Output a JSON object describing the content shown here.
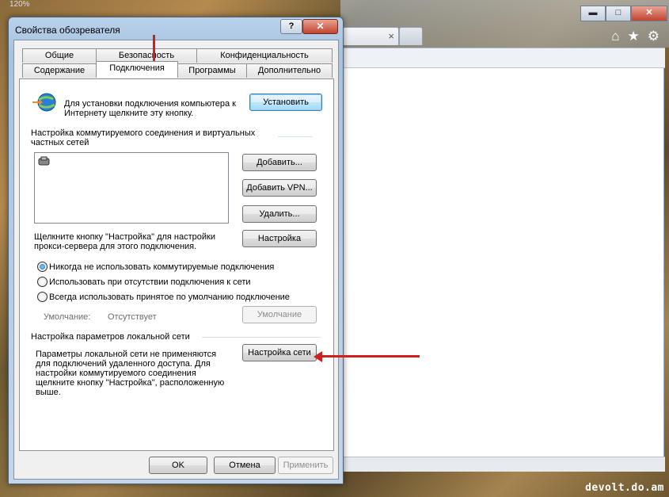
{
  "background": {
    "zoom": "120%",
    "watermark": "devolt.do.am",
    "window_controls": {
      "minimize": "▬",
      "maximize": "□",
      "close": "✕"
    },
    "tab_close": "×",
    "icons": [
      "home-icon",
      "star-icon",
      "gear-icon"
    ]
  },
  "dialog": {
    "title": "Свойства обозревателя",
    "help_label": "?",
    "close_label": "✕",
    "tabs_row1": [
      "Общие",
      "Безопасность",
      "Конфиденциальность"
    ],
    "tabs_row2": [
      "Содержание",
      "Подключения",
      "Программы",
      "Дополнительно"
    ],
    "active_tab": "Подключения",
    "setup": {
      "text": "Для установки подключения компьютера к Интернету щелкните эту кнопку.",
      "button": "Установить"
    },
    "dialup": {
      "header": "Настройка коммутируемого соединения и виртуальных частных сетей",
      "add": "Добавить...",
      "add_vpn": "Добавить VPN...",
      "remove": "Удалить...",
      "settings_text": "Щелкните кнопку \"Настройка\" для настройки прокси-сервера для этого подключения.",
      "settings_button": "Настройка"
    },
    "radios": [
      {
        "label": "Никогда не использовать коммутируемые подключения",
        "checked": true
      },
      {
        "label": "Использовать при отсутствии подключения к сети",
        "checked": false
      },
      {
        "label": "Всегда использовать принятое по умолчанию подключение",
        "checked": false
      }
    ],
    "default_row": {
      "label": "Умолчание:",
      "value": "Отсутствует",
      "button": "Умолчание"
    },
    "lan": {
      "header": "Настройка параметров локальной сети",
      "text": "Параметры локальной сети не применяются для подключений удаленного доступа. Для настройки коммутируемого соединения щелкните кнопку \"Настройка\", расположенную выше.",
      "button": "Настройка сети"
    },
    "footer": {
      "ok": "OK",
      "cancel": "Отмена",
      "apply": "Применить"
    }
  }
}
